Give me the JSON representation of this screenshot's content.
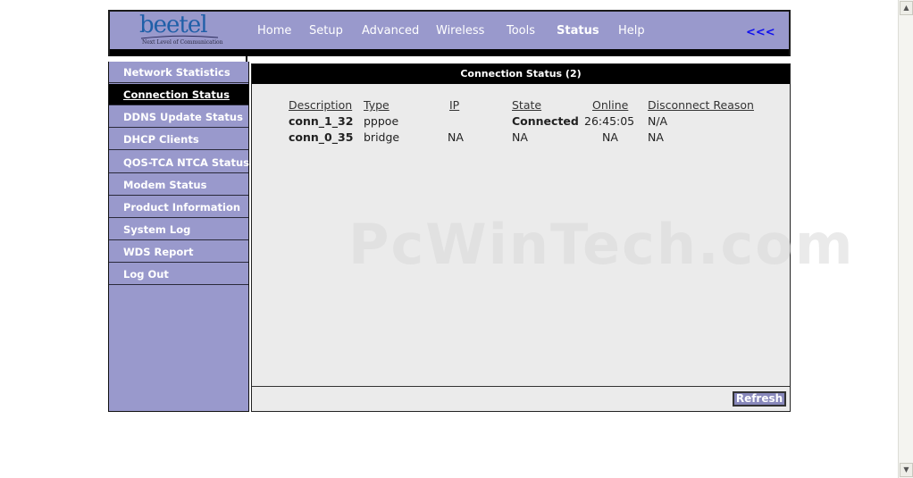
{
  "brand": {
    "logo_text": "beetel",
    "tagline": "Next Level of Communication"
  },
  "nav": {
    "items": [
      "Home",
      "Setup",
      "Advanced",
      "Wireless",
      "Tools",
      "Status",
      "Help"
    ],
    "active": "Status",
    "back_label": "<<<"
  },
  "sidebar": {
    "items": [
      {
        "label": "Network Statistics"
      },
      {
        "label": "Connection Status"
      },
      {
        "label": "DDNS Update Status"
      },
      {
        "label": "DHCP Clients"
      },
      {
        "label": "QOS-TCA NTCA Status"
      },
      {
        "label": "Modem Status"
      },
      {
        "label": "Product Information"
      },
      {
        "label": "System Log"
      },
      {
        "label": "WDS Report"
      },
      {
        "label": "Log Out"
      }
    ],
    "selected": "Connection Status"
  },
  "panel": {
    "title": "Connection Status (2)",
    "columns": [
      "Description",
      "Type",
      "IP",
      "State",
      "Online",
      "Disconnect Reason"
    ],
    "rows": [
      {
        "description": "conn_1_32",
        "type": "pppoe",
        "ip": "",
        "state": "Connected",
        "online": "26:45:05",
        "reason": "N/A"
      },
      {
        "description": "conn_0_35",
        "type": "bridge",
        "ip": "NA",
        "state": "NA",
        "online": "NA",
        "reason": "NA"
      }
    ],
    "refresh_label": "Refresh"
  },
  "watermark": "PcWinTech.com",
  "colors": {
    "frame": "#9999cc",
    "bar": "#000000",
    "panel": "#ebebeb",
    "back_link": "#1010ee"
  }
}
